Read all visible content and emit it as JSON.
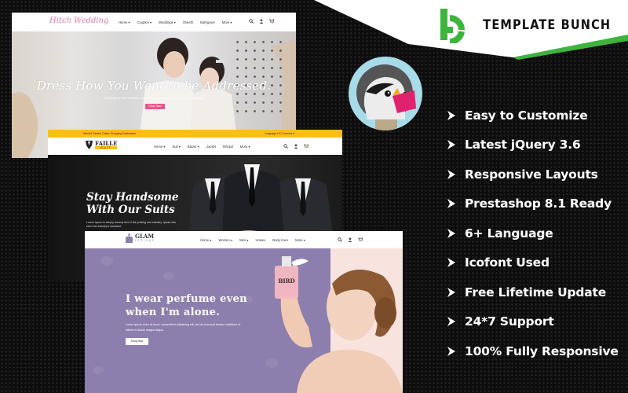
{
  "brand": {
    "name": "TEMPLATE BUNCH",
    "accent": "#3db53d"
  },
  "features": [
    "Easy to Customize",
    "Latest jQuery 3.6",
    "Responsive Layouts",
    "Prestashop 8.1 Ready",
    "6+ Language",
    "Icofont Used",
    "Free Lifetime Update",
    "24*7 Support",
    "100% Fully Responsive"
  ],
  "platform_logo": "prestashop-puffin",
  "screens": {
    "wedding": {
      "logo": "Hitch Wedding",
      "nav": [
        "Home ▾",
        "Couples ▾",
        "Weddings ▾",
        "Sheeth",
        "Bathgown",
        "More ▾"
      ],
      "hero_title": "Dress How You Want to be Addressed.",
      "hero_sub": "Lorem ipsum dolor sit amet, consectetur adipiscing elit, sed do eiusmod tempor.",
      "hero_button": "Shop Now",
      "accent": "#e7578a"
    },
    "suit": {
      "topbar_left": "World's Fastest Online Shopping Destination",
      "topbar_right": "Language ▾  $ Currency ▾",
      "logo": "FAILLE",
      "logo_sub": "SUIT",
      "nav": [
        "Home ▾",
        "Suit ▾",
        "Blazer ▾",
        "Jacket",
        "Brinijal",
        "More ▾"
      ],
      "hero_title_1": "Stay Handsome",
      "hero_title_2": "With Our Suits",
      "hero_sub": "Lorem Ipsum is simply dummy text of the printing and industry. Ipsum has been the industry's standard.",
      "accent": "#fdbd19"
    },
    "perfume": {
      "logo": "GLAM",
      "logo_sub": "PERFUME",
      "nav": [
        "Home ▾",
        "Women ▾",
        "Men ▾",
        "Unisex",
        "Body Care",
        "More ▾"
      ],
      "hero_title_1": "I wear perfume even",
      "hero_title_2": "when I'm alone.",
      "hero_sub": "Lorem ipsum dolor sit amet, consectetur adipiscing elit, sed do eiusmod tempor incididunt ut labore et dolore magna aliqua.",
      "hero_button": "Shop Now",
      "bottle_label": "BIRD",
      "accent": "#8d7fad"
    }
  }
}
